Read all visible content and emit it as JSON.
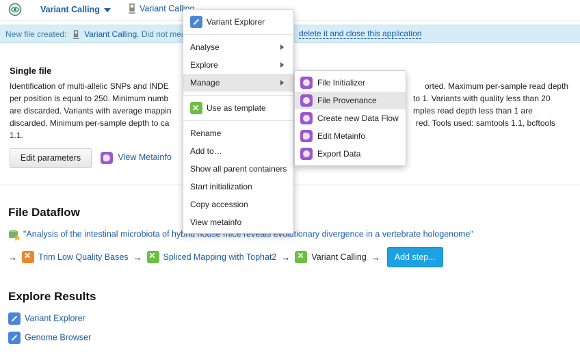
{
  "topbar": {
    "app_title": "Variant Calling",
    "breadcrumb": "Variant Calling"
  },
  "notification": {
    "prefix": "New file created:",
    "file_name": "Variant Calling.",
    "middle": "Did not mea",
    "link": "delete it and close this application"
  },
  "single_file": {
    "title": "Single file",
    "description_lines": [
      "Identification of multi-allelic SNPs and INDE",
      "per position is equal to 250. Minimum numb",
      "are discarded. Variants with average mappin",
      "discarded. Minimum per-sample depth to ca",
      "1.1."
    ],
    "description_right": [
      "orted. Maximum per-sample read depth",
      "to 1. Variants with quality less than 20",
      "mples read depth less than 1 are",
      "red. Tools used: samtools 1.1, bcftools"
    ],
    "edit_button": "Edit parameters",
    "view_metainfo": "View Metainfo"
  },
  "dataflow": {
    "title": "File Dataflow",
    "project": "\"Analysis of the intestinal microbiota of hybrid house mice reveals evolutionary divergence in a vertebrate hologenome\"",
    "steps": [
      {
        "label": "Trim Low Quality Bases",
        "color": "orange"
      },
      {
        "label": "Spliced Mapping with Tophat2",
        "color": "green"
      },
      {
        "label": "Variant Calling",
        "color": "green"
      }
    ],
    "arrow": "→",
    "add_step": "Add step..."
  },
  "explore": {
    "title": "Explore Results",
    "items": [
      "Variant Explorer",
      "Genome Browser"
    ]
  },
  "context_menu": {
    "items": [
      {
        "label": "Variant Explorer",
        "icon": "variant-explorer-icon"
      },
      {
        "label": "Analyse",
        "submenu": true
      },
      {
        "label": "Explore",
        "submenu": true
      },
      {
        "label": "Manage",
        "submenu": true,
        "active": true
      },
      {
        "label": "Use as template",
        "icon": "template-icon"
      },
      {
        "label": "Rename"
      },
      {
        "label": "Add to…"
      },
      {
        "label": "Show all parent containers"
      },
      {
        "label": "Start initialization"
      },
      {
        "label": "Copy accession"
      },
      {
        "label": "View metainfo"
      }
    ]
  },
  "submenu": {
    "items": [
      {
        "label": "File Initializer"
      },
      {
        "label": "File Provenance",
        "active": true
      },
      {
        "label": "Create new Data Flow"
      },
      {
        "label": "Edit Metainfo"
      },
      {
        "label": "Export Data"
      }
    ]
  },
  "colors": {
    "link": "#1c5ba8",
    "notification_bg": "#d6ecf7",
    "add_step_bg": "#1da1e2",
    "purple_icon": "#9b59c9",
    "green_icon": "#6dbf44",
    "orange_icon": "#e8892d"
  }
}
